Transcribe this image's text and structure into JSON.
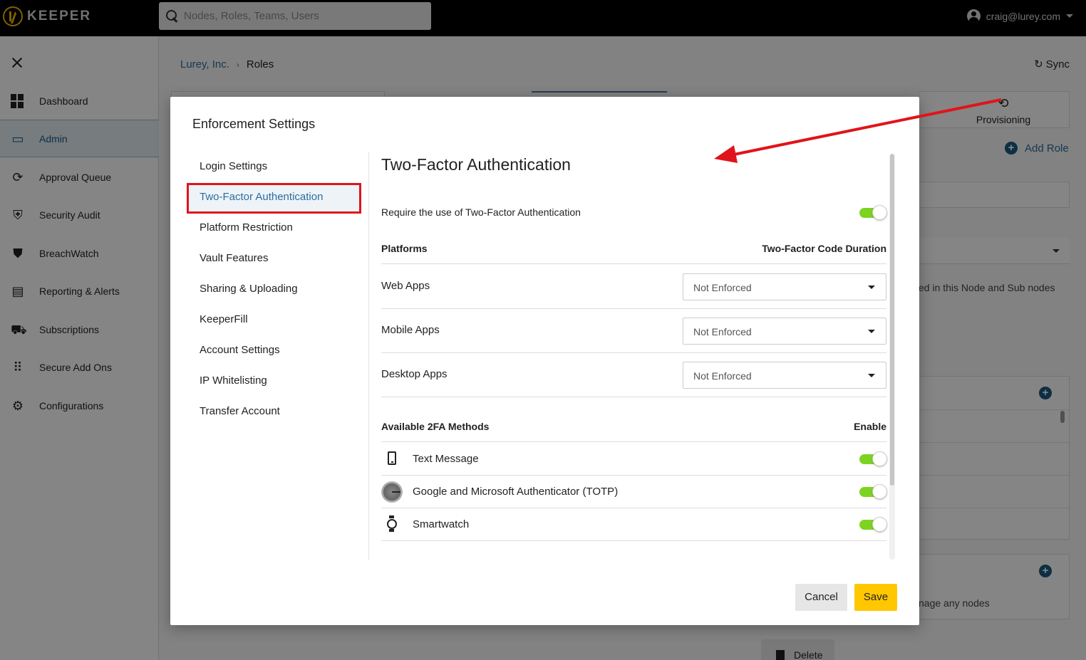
{
  "app": {
    "brand": "KEEPER",
    "search_placeholder": "Nodes, Roles, Teams, Users",
    "user": "craig@lurey.com"
  },
  "sidebar": {
    "items": [
      {
        "label": "Dashboard",
        "icon": "dashboard-icon"
      },
      {
        "label": "Admin",
        "icon": "admin-icon",
        "active": true
      },
      {
        "label": "Approval Queue",
        "icon": "approval-queue-icon"
      },
      {
        "label": "Security Audit",
        "icon": "shield-icon"
      },
      {
        "label": "BreachWatch",
        "icon": "breachwatch-icon"
      },
      {
        "label": "Reporting & Alerts",
        "icon": "clipboard-icon"
      },
      {
        "label": "Subscriptions",
        "icon": "cart-icon"
      },
      {
        "label": "Secure Add Ons",
        "icon": "grid-icon"
      },
      {
        "label": "Configurations",
        "icon": "gear-icon"
      }
    ]
  },
  "page": {
    "breadcrumb": {
      "root": "Lurey, Inc.",
      "current": "Roles"
    },
    "sync_label": "Sync",
    "provisioning_label": "Provisioning",
    "add_role_label": "Add Role",
    "node_note": "ed in this Node and Sub nodes",
    "manage_note": "nage any nodes",
    "delete_label": "Delete"
  },
  "modal": {
    "title": "Enforcement Settings",
    "nav": [
      "Login Settings",
      "Two-Factor Authentication",
      "Platform Restriction",
      "Vault Features",
      "Sharing & Uploading",
      "KeeperFill",
      "Account Settings",
      "IP Whitelisting",
      "Transfer Account"
    ],
    "selected_nav": "Two-Factor Authentication",
    "content": {
      "title": "Two-Factor Authentication",
      "require_label": "Require the use of Two-Factor Authentication",
      "require_enabled": true,
      "platforms_header": "Platforms",
      "duration_header": "Two-Factor Code Duration",
      "platforms": [
        {
          "label": "Web Apps",
          "value": "Not Enforced"
        },
        {
          "label": "Mobile Apps",
          "value": "Not Enforced"
        },
        {
          "label": "Desktop Apps",
          "value": "Not Enforced"
        }
      ],
      "methods_header": "Available 2FA Methods",
      "enable_header": "Enable",
      "methods": [
        {
          "label": "Text Message",
          "icon": "phone-icon",
          "enabled": true
        },
        {
          "label": "Google and Microsoft Authenticator (TOTP)",
          "icon": "totp-icon",
          "enabled": true
        },
        {
          "label": "Smartwatch",
          "icon": "watch-icon",
          "enabled": true
        }
      ]
    },
    "cancel_label": "Cancel",
    "save_label": "Save"
  },
  "colors": {
    "accent": "#2b6ea0",
    "toggle_on": "#7ed321",
    "save": "#ffc700",
    "highlight": "#e0141b"
  }
}
